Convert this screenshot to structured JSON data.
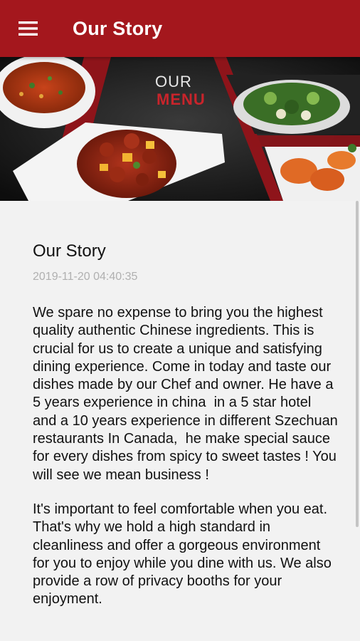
{
  "appbar": {
    "title": "Our Story",
    "menu_icon": "hamburger-icon",
    "color": "#a4171d"
  },
  "banner": {
    "line1": "OUR",
    "line2": "MENU",
    "accent": "#c8242b"
  },
  "story": {
    "title": "Our Story",
    "date": "2019-11-20 04:40:35",
    "paragraphs": [
      "We spare no expense to bring you the highest quality authentic Chinese ingredients. This is crucial for us to create a unique and satisfying dining experience. Come in today and taste our dishes made by our Chef and owner. He have a 5 years experience in china  in a 5 star hotel and a 10 years experience in different Szechuan restaurants In Canada,  he make special sauce for every dishes from spicy to sweet tastes ! You will see we mean business !",
      "It's important to feel comfortable when you eat. That's why we hold a high standard in cleanliness and offer a gorgeous environment for you to enjoy while you dine with us. We also provide a row of privacy booths for your enjoyment."
    ]
  }
}
